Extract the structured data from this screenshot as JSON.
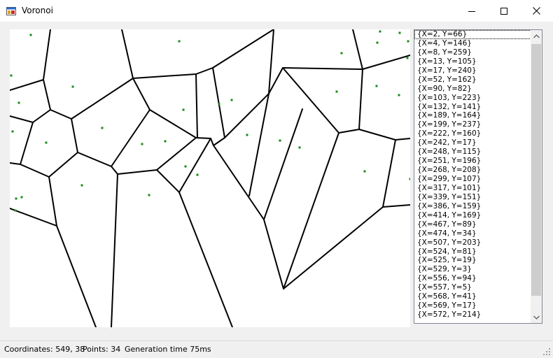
{
  "window": {
    "title": "Voronoi"
  },
  "app_icon": "windows-forms-app-icon",
  "controls": {
    "minimize": "minimize-icon",
    "maximize": "maximize-icon",
    "close": "close-icon"
  },
  "points": [
    {
      "label": "{X=2, Y=66}"
    },
    {
      "label": "{X=4, Y=146}"
    },
    {
      "label": "{X=8, Y=259}"
    },
    {
      "label": "{X=13, Y=105}"
    },
    {
      "label": "{X=17, Y=240}"
    },
    {
      "label": "{X=52, Y=162}"
    },
    {
      "label": "{X=90, Y=82}"
    },
    {
      "label": "{X=103, Y=223}"
    },
    {
      "label": "{X=132, Y=141}"
    },
    {
      "label": "{X=189, Y=164}"
    },
    {
      "label": "{X=199, Y=237}"
    },
    {
      "label": "{X=222, Y=160}"
    },
    {
      "label": "{X=242, Y=17}"
    },
    {
      "label": "{X=248, Y=115}"
    },
    {
      "label": "{X=251, Y=196}"
    },
    {
      "label": "{X=268, Y=208}"
    },
    {
      "label": "{X=299, Y=107}"
    },
    {
      "label": "{X=317, Y=101}"
    },
    {
      "label": "{X=339, Y=151}"
    },
    {
      "label": "{X=386, Y=159}"
    },
    {
      "label": "{X=414, Y=169}"
    },
    {
      "label": "{X=467, Y=89}"
    },
    {
      "label": "{X=474, Y=34}"
    },
    {
      "label": "{X=507, Y=203}"
    },
    {
      "label": "{X=524, Y=81}"
    },
    {
      "label": "{X=525, Y=19}"
    },
    {
      "label": "{X=529, Y=3}"
    },
    {
      "label": "{X=556, Y=94}"
    },
    {
      "label": "{X=557, Y=5}"
    },
    {
      "label": "{X=568, Y=41}"
    },
    {
      "label": "{X=569, Y=17}"
    },
    {
      "label": "{X=572, Y=214}"
    }
  ],
  "selected_index": 0,
  "status": {
    "coordinates": "Coordinates: 549, 38",
    "points": "Points: 34",
    "generation": "Generation time 75ms"
  },
  "colors": {
    "point": "#1a8a1a",
    "edge": "#000000",
    "selection": "#000000"
  }
}
